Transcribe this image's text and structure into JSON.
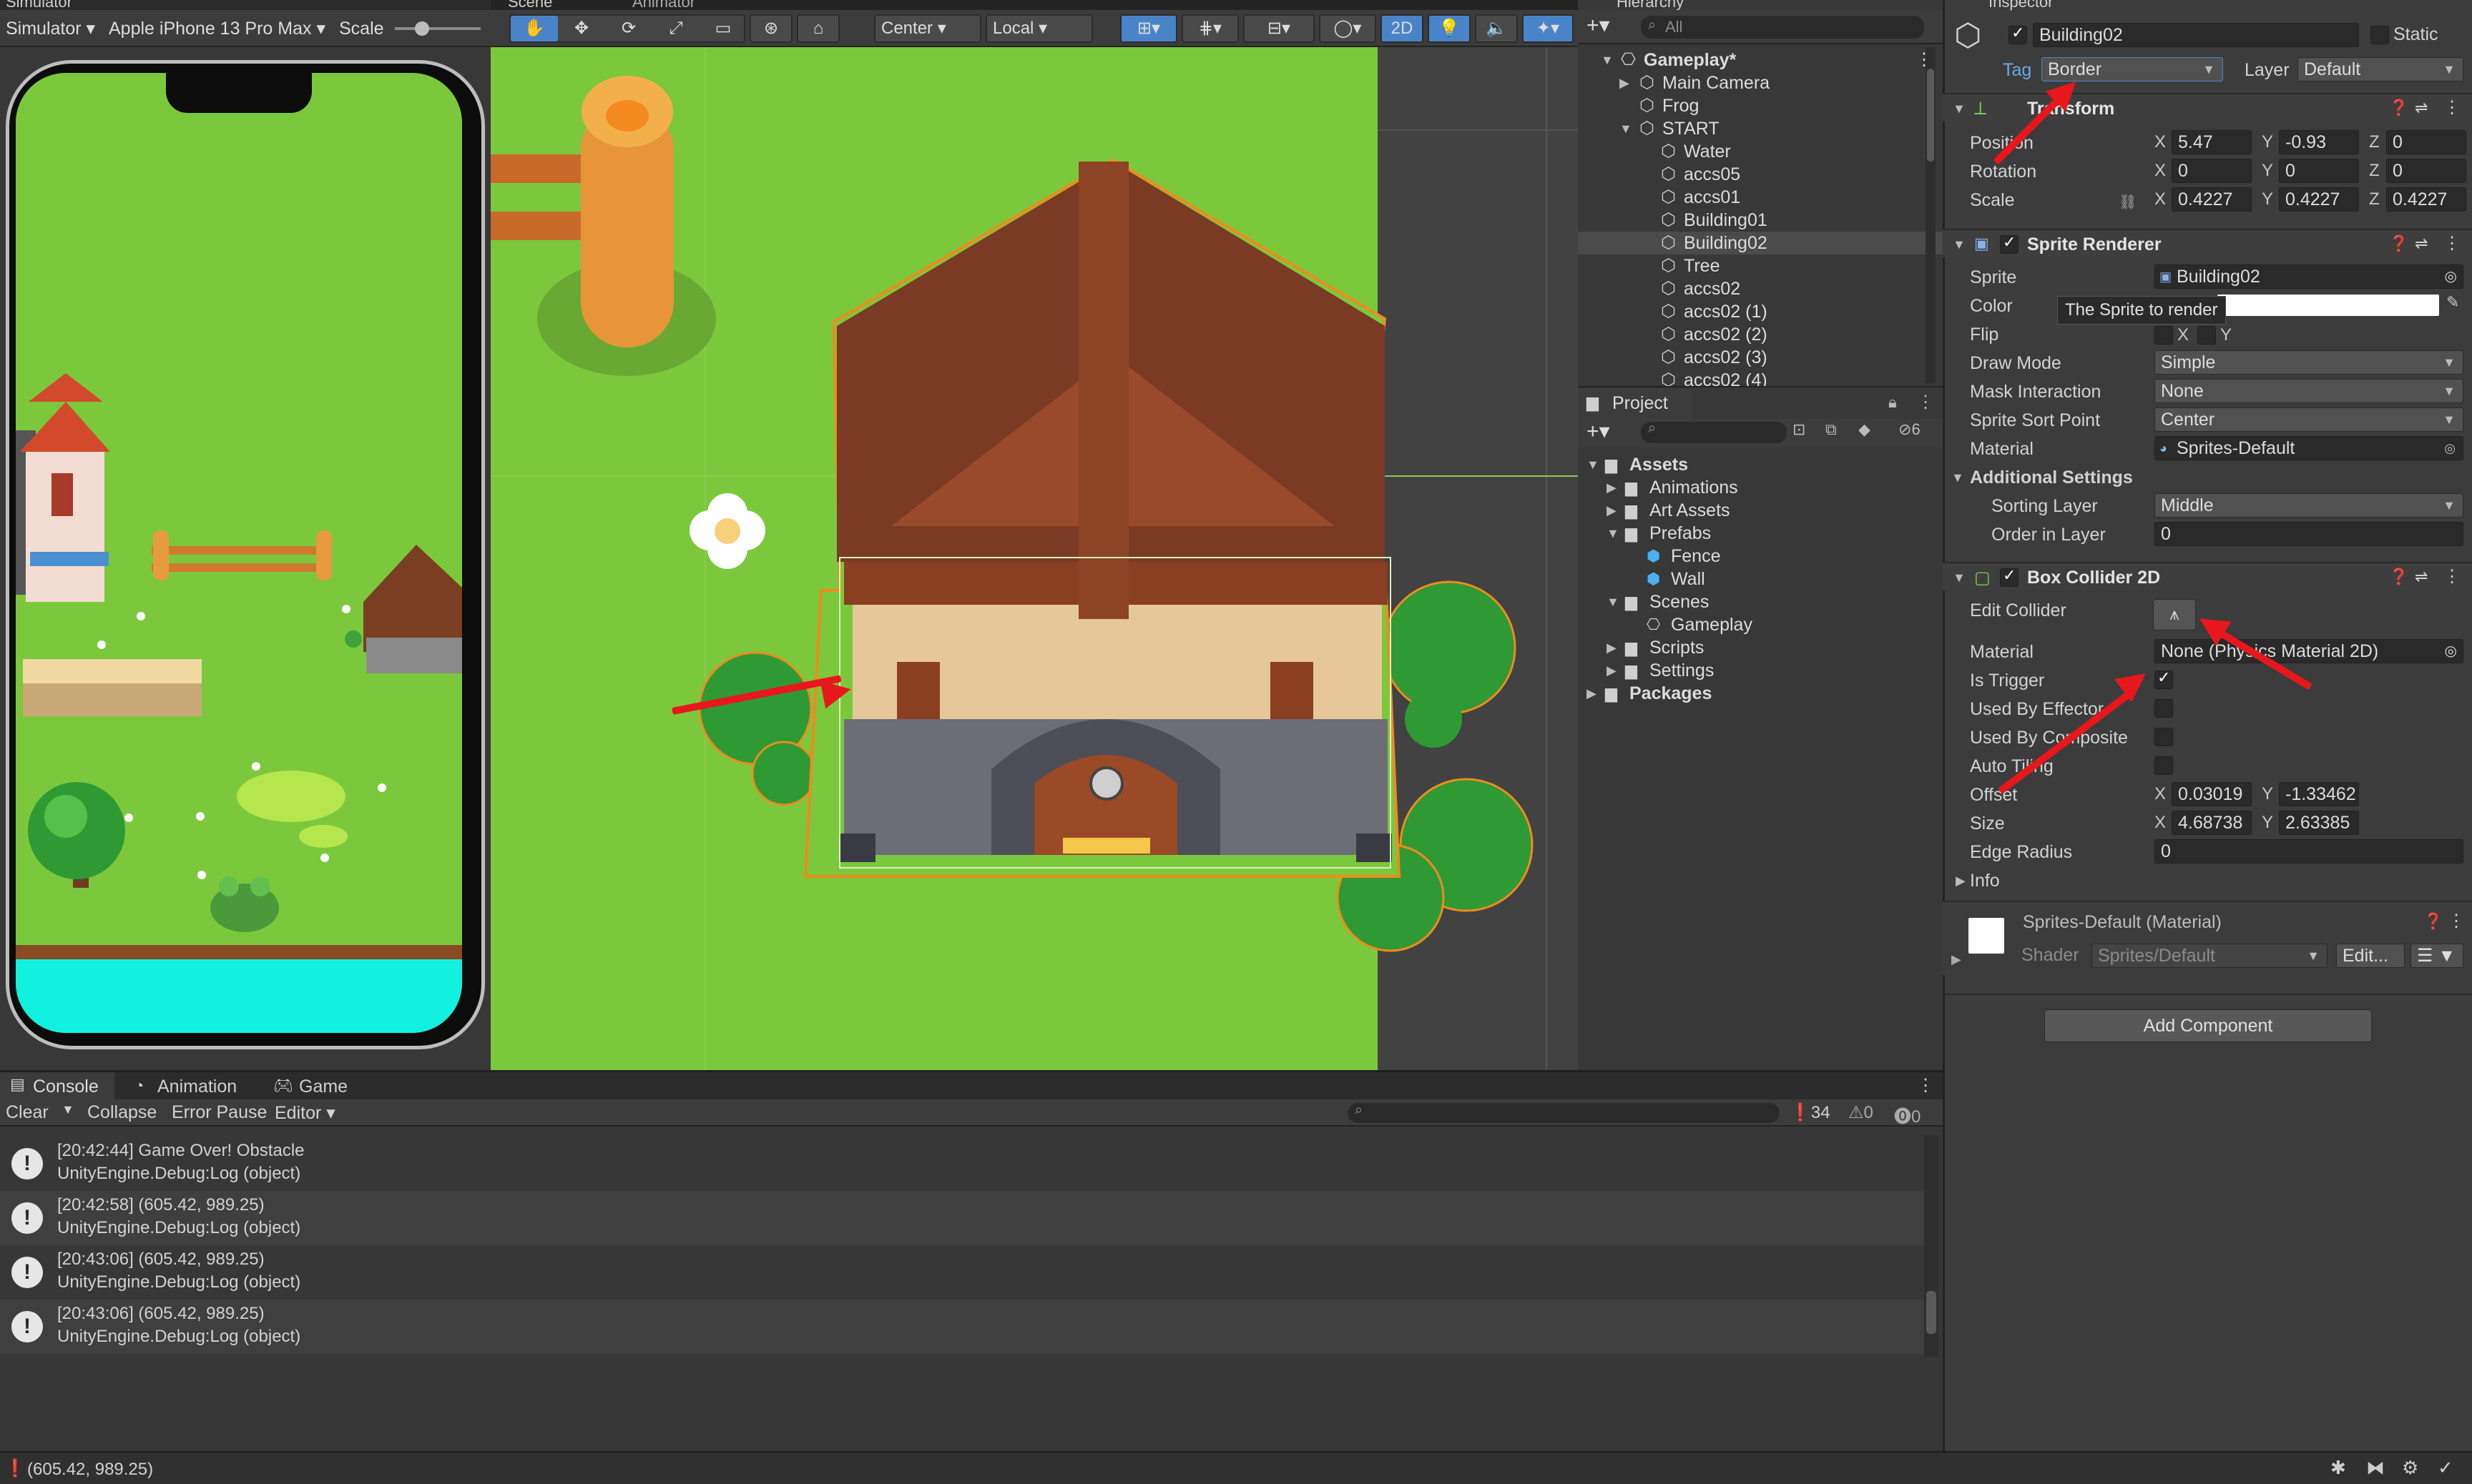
{
  "simulator": {
    "tab": "Simulator",
    "mode": "Simulator",
    "device": "Apple iPhone 13 Pro Max",
    "scale_label": "Scale"
  },
  "scene": {
    "tab_scene": "Scene",
    "tab_animator": "Animator",
    "pivot": "Center",
    "space": "Local",
    "mode_2d": "2D"
  },
  "hierarchy": {
    "tab": "Hierarchy",
    "search_placeholder": "All",
    "rows": [
      {
        "label": "Gameplay*",
        "depth": 0
      },
      {
        "label": "Main Camera",
        "depth": 1
      },
      {
        "label": "Frog",
        "depth": 1
      },
      {
        "label": "START",
        "depth": 1
      },
      {
        "label": "Water",
        "depth": 2
      },
      {
        "label": "accs05",
        "depth": 2
      },
      {
        "label": "accs01",
        "depth": 2
      },
      {
        "label": "Building01",
        "depth": 2
      },
      {
        "label": "Building02",
        "depth": 2,
        "selected": true
      },
      {
        "label": "Tree",
        "depth": 2
      },
      {
        "label": "accs02",
        "depth": 2
      },
      {
        "label": "accs02 (1)",
        "depth": 2
      },
      {
        "label": "accs02 (2)",
        "depth": 2
      },
      {
        "label": "accs02 (3)",
        "depth": 2
      },
      {
        "label": "accs02 (4)",
        "depth": 2
      }
    ]
  },
  "project": {
    "tab": "Project",
    "hidden_count": "6",
    "tree": [
      "Assets",
      "Animations",
      "Art Assets",
      "Prefabs",
      "Fence",
      "Wall",
      "Scenes",
      "Gameplay",
      "Scripts",
      "Settings",
      "Packages"
    ]
  },
  "inspector": {
    "tab": "Inspector",
    "object_name": "Building02",
    "static_label": "Static",
    "tag_label": "Tag",
    "tag_value": "Border",
    "layer_label": "Layer",
    "layer_value": "Default",
    "transform": {
      "title": "Transform",
      "position_label": "Position",
      "position": {
        "x": "5.47",
        "y": "-0.93",
        "z": "0"
      },
      "rotation_label": "Rotation",
      "rotation": {
        "x": "0",
        "y": "0",
        "z": "0"
      },
      "scale_label": "Scale",
      "scale": {
        "x": "0.4227",
        "y": "0.4227",
        "z": "0.4227"
      }
    },
    "sprite_renderer": {
      "title": "Sprite Renderer",
      "sprite_label": "Sprite",
      "sprite_value": "Building02",
      "color_label": "Color",
      "tooltip": "The Sprite to render",
      "flip_label": "Flip",
      "flip_x": "X",
      "flip_y": "Y",
      "draw_mode_label": "Draw Mode",
      "draw_mode": "Simple",
      "mask_label": "Mask Interaction",
      "mask": "None",
      "sort_point_label": "Sprite Sort Point",
      "sort_point": "Center",
      "material_label": "Material",
      "material": "Sprites-Default",
      "additional_label": "Additional Settings",
      "sorting_layer_label": "Sorting Layer",
      "sorting_layer": "Middle",
      "order_label": "Order in Layer",
      "order": "0"
    },
    "box_collider": {
      "title": "Box Collider 2D",
      "edit_label": "Edit Collider",
      "material_label": "Material",
      "material": "None (Physics Material 2D)",
      "is_trigger_label": "Is Trigger",
      "is_trigger": true,
      "used_by_effector_label": "Used By Effector",
      "used_by_composite_label": "Used By Composite",
      "auto_tiling_label": "Auto Tiling",
      "offset_label": "Offset",
      "offset": {
        "x": "0.03019",
        "y": "-1.33462"
      },
      "size_label": "Size",
      "size": {
        "x": "4.68738",
        "y": "2.63385"
      },
      "edge_label": "Edge Radius",
      "edge": "0",
      "info_label": "Info"
    },
    "material_block": {
      "title": "Sprites-Default (Material)",
      "shader_label": "Shader",
      "shader": "Sprites/Default",
      "edit": "Edit..."
    },
    "add_component": "Add Component"
  },
  "console": {
    "tab_console": "Console",
    "tab_animation": "Animation",
    "tab_game": "Game",
    "clear": "Clear",
    "collapse": "Collapse",
    "error_pause": "Error Pause",
    "editor": "Editor",
    "count_log": "34",
    "count_warn": "0",
    "count_err": "0",
    "entries": [
      {
        "line1": "[20:42:44] Game Over! Obstacle",
        "line2": "UnityEngine.Debug:Log (object)"
      },
      {
        "line1": "[20:42:58] (605.42, 989.25)",
        "line2": "UnityEngine.Debug:Log (object)"
      },
      {
        "line1": "[20:43:06] (605.42, 989.25)",
        "line2": "UnityEngine.Debug:Log (object)"
      },
      {
        "line1": "[20:43:06] (605.42, 989.25)",
        "line2": "UnityEngine.Debug:Log (object)"
      }
    ]
  },
  "status": {
    "message": "(605.42, 989.25)"
  },
  "colors": {
    "annotation_arrow": "#e8171c",
    "grass": "#7cc83c",
    "selection": "#4b4b4b",
    "water": "#12f0e0"
  }
}
